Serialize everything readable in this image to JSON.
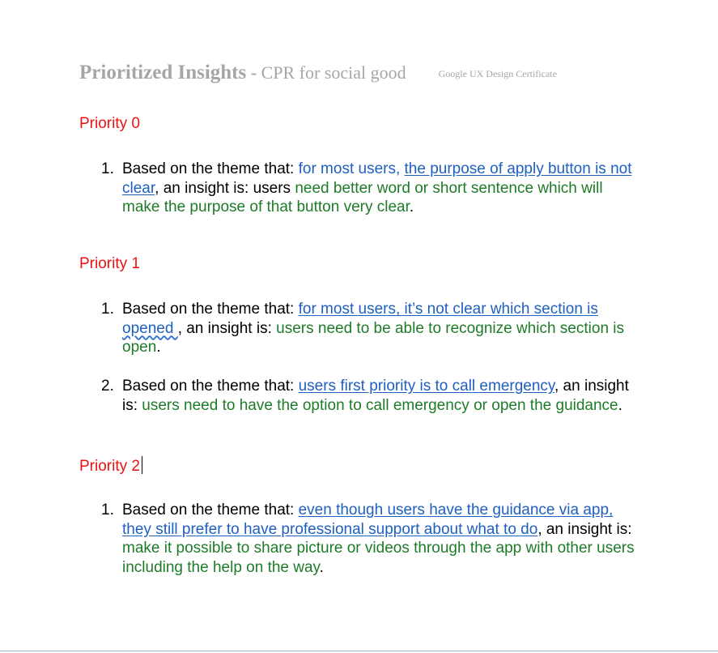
{
  "document": {
    "title": "Prioritized Insights",
    "separator": " - ",
    "subtitle": "CPR for social good",
    "certificate": "Google UX Design Certificate"
  },
  "sections": [
    {
      "heading": "Priority 0",
      "items": [
        {
          "number": "1.",
          "lead": "Based on the theme that: ",
          "theme_plain": "for most users, ",
          "theme_link": "the purpose of apply button is not clear",
          "connector": ", an insight is: users ",
          "insight": "need better word or short sentence which will make the purpose of that button very clear",
          "end": "."
        }
      ]
    },
    {
      "heading": "Priority 1",
      "items": [
        {
          "number": "1.",
          "lead": "Based on the theme that: ",
          "theme_link": "for most users, it’s not clear which section is ",
          "theme_link_spell": " opened ",
          "connector": " , an insight is: ",
          "insight": "users need to be able to recognize which section is open",
          "end": "."
        },
        {
          "number": "2.",
          "lead": "Based on the theme that: ",
          "theme_link": "users first priority is to call emergency",
          "connector": ", an insight is: ",
          "insight": "users need to have the option to call emergency or open the guidance",
          "end": "."
        }
      ]
    },
    {
      "heading": "Priority 2",
      "items": [
        {
          "number": "1.",
          "lead": "Based on the theme that: ",
          "theme_link": "even though users have the guidance via app, they still prefer to have professional support about what to do",
          "connector": ", an insight is: ",
          "insight": "make it possible to share picture or videos through the app with other users including the help on the way",
          "end": "."
        }
      ]
    }
  ]
}
